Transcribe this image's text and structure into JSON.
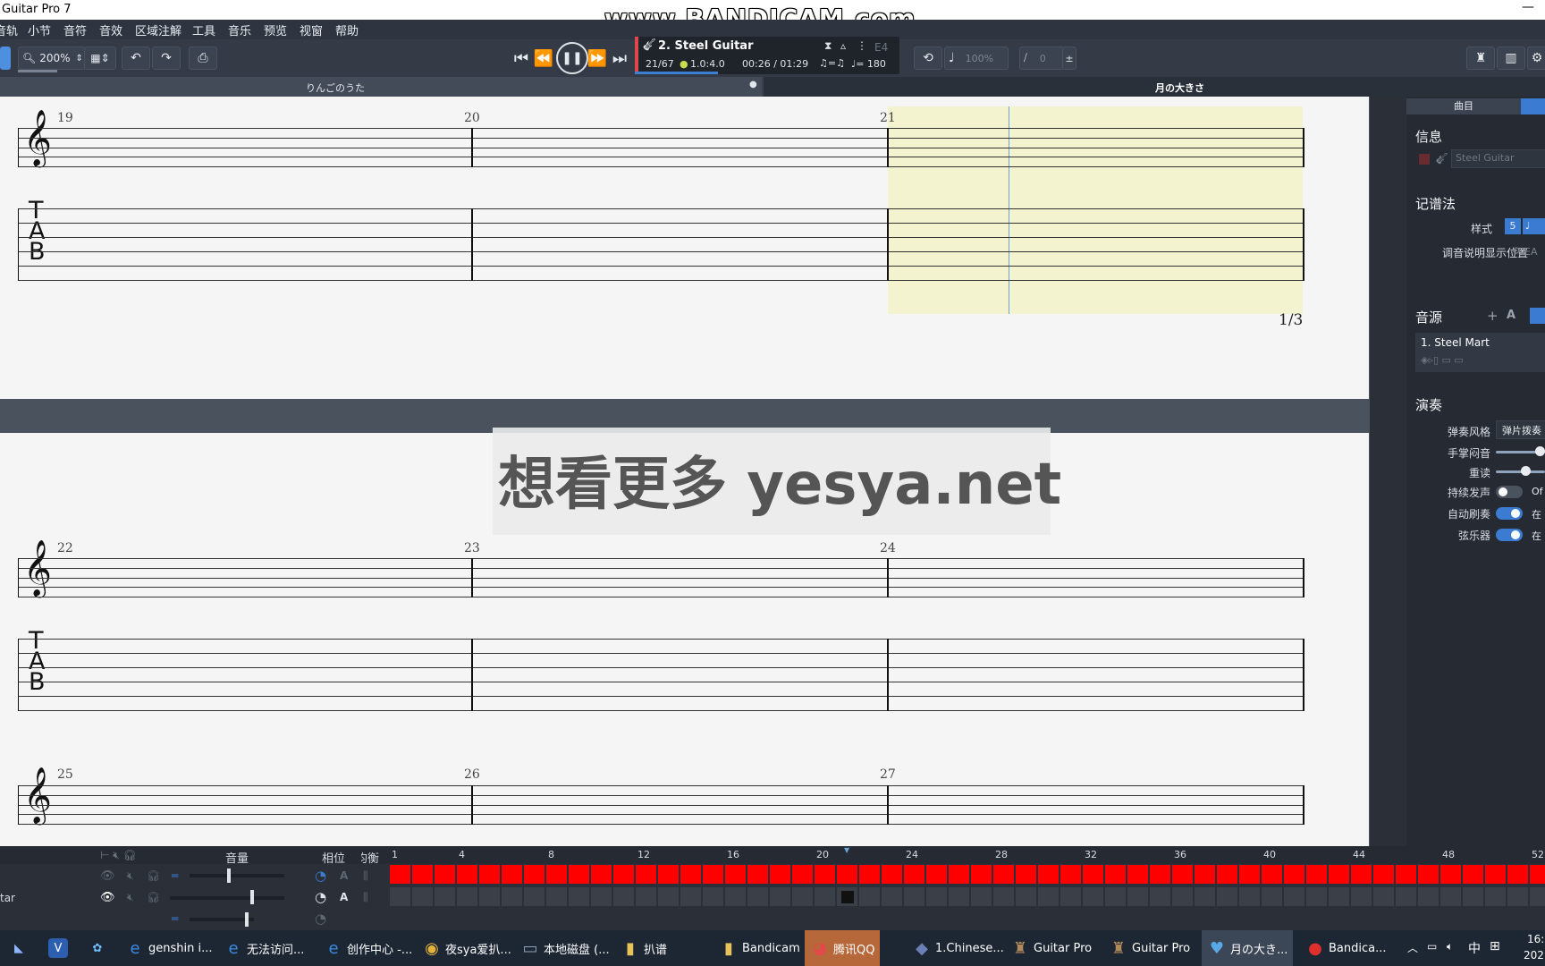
{
  "app": {
    "title": "Guitar Pro 7",
    "recording_watermark": "www.BANDICAM.com"
  },
  "menu": [
    "音轨",
    "小节",
    "音符",
    "音效",
    "区域注解",
    "工具",
    "音乐",
    "预览",
    "视窗",
    "帮助"
  ],
  "toolbar": {
    "zoom": "200%",
    "track_name": "2. Steel Guitar",
    "bar_position": "21/67",
    "signature": "1.0:4.0",
    "time": "00:26 / 01:29",
    "tempo": "♩= 180",
    "pitch": "E4",
    "speed": "100%",
    "capo": "0"
  },
  "tabs": [
    {
      "label": "りんごのうた",
      "modified": "●"
    },
    {
      "label": "月の大きさ"
    }
  ],
  "score": {
    "page_number": "1/3",
    "systems": [
      {
        "measures": [
          "19",
          "20",
          "21"
        ]
      },
      {
        "measures": [
          "22",
          "23",
          "24"
        ]
      },
      {
        "measures": [
          "25",
          "26",
          "27"
        ]
      }
    ],
    "tab_letters": [
      "T",
      "A",
      "B"
    ]
  },
  "watermark_overlay": "想看更多 yesya.net",
  "right_panel": {
    "top_tab": "曲目",
    "info_title": "信息",
    "track_field_placeholder": "Steel Guitar",
    "notation_title": "记谱法",
    "style_label": "样式",
    "tuning_label": "调音说明显示位置",
    "tuning_value": "EA",
    "sound_title": "音源",
    "sound_item": "1. Steel Mart",
    "perform_title": "演奏",
    "pick_style_label": "弹奏风格",
    "pick_style_value": "弹片拨奏",
    "palm_mute_label": "手掌闷音",
    "accent_label": "重读",
    "sustain_label": "持续发声",
    "sustain_value": "Of",
    "auto_strum_label": "自动刷奏",
    "auto_strum_value": "在",
    "string_label": "弦乐器",
    "string_value": "在"
  },
  "tracks_panel": {
    "col_volume": "音量",
    "col_pan": "相位",
    "col_eq": "均衡",
    "track_name": "tar",
    "ruler": [
      "1",
      "4",
      "8",
      "12",
      "16",
      "20",
      "24",
      "28",
      "32",
      "36",
      "40",
      "44",
      "48",
      "52"
    ],
    "colors": {
      "filled": "#ff0000",
      "empty": "#3a3f48"
    }
  },
  "taskbar": [
    {
      "label": "genshin i...",
      "icon": "ie-icon"
    },
    {
      "label": "无法访问...",
      "icon": "ie-icon"
    },
    {
      "label": "创作中心 -...",
      "icon": "ie-icon"
    },
    {
      "label": "夜sya爱扒...",
      "icon": "chrome-icon"
    },
    {
      "label": "本地磁盘 (...",
      "icon": "drive-icon"
    },
    {
      "label": "扒谱",
      "icon": "folder-icon"
    },
    {
      "label": "Bandicam",
      "icon": "folder-icon"
    },
    {
      "label": "腾讯QQ",
      "icon": "qq-icon"
    },
    {
      "label": "1.Chinese...",
      "icon": "app-icon"
    },
    {
      "label": "Guitar Pro",
      "icon": "gp-icon"
    },
    {
      "label": "Guitar Pro",
      "icon": "gp-icon"
    },
    {
      "label": "月の大き...",
      "icon": "gp-doc-icon"
    },
    {
      "label": "Bandica...",
      "icon": "record-icon"
    }
  ],
  "systray": {
    "ime": "中",
    "time": "16:",
    "date": "202"
  }
}
